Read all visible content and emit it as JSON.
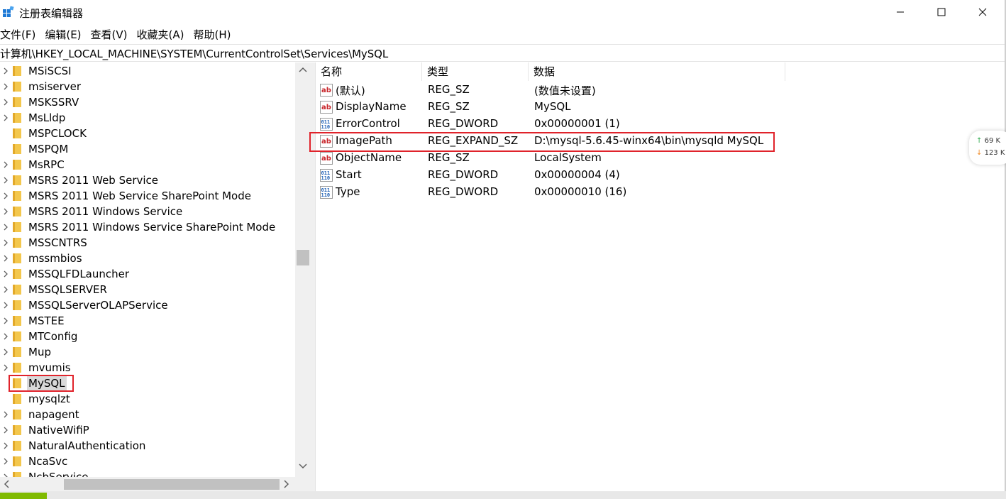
{
  "window": {
    "title": "注册表编辑器",
    "controls": {
      "minimize": "minimize-icon",
      "maximize": "maximize-icon",
      "close": "close-icon"
    }
  },
  "menu": [
    "文件(F)",
    "编辑(E)",
    "查看(V)",
    "收藏夹(A)",
    "帮助(H)"
  ],
  "address": "计算机\\HKEY_LOCAL_MACHINE\\SYSTEM\\CurrentControlSet\\Services\\MySQL",
  "tree": {
    "items": [
      {
        "label": "MSiSCSI",
        "expandable": true
      },
      {
        "label": "msiserver",
        "expandable": true
      },
      {
        "label": "MSKSSRV",
        "expandable": true
      },
      {
        "label": "MsLldp",
        "expandable": true
      },
      {
        "label": "MSPCLOCK",
        "expandable": false
      },
      {
        "label": "MSPQM",
        "expandable": false
      },
      {
        "label": "MsRPC",
        "expandable": true
      },
      {
        "label": "MSRS 2011 Web Service",
        "expandable": true
      },
      {
        "label": "MSRS 2011 Web Service SharePoint Mode",
        "expandable": true
      },
      {
        "label": "MSRS 2011 Windows Service",
        "expandable": true
      },
      {
        "label": "MSRS 2011 Windows Service SharePoint Mode",
        "expandable": true
      },
      {
        "label": "MSSCNTRS",
        "expandable": true
      },
      {
        "label": "mssmbios",
        "expandable": true
      },
      {
        "label": "MSSQLFDLauncher",
        "expandable": true
      },
      {
        "label": "MSSQLSERVER",
        "expandable": true
      },
      {
        "label": "MSSQLServerOLAPService",
        "expandable": true
      },
      {
        "label": "MSTEE",
        "expandable": true
      },
      {
        "label": "MTConfig",
        "expandable": true
      },
      {
        "label": "Mup",
        "expandable": true
      },
      {
        "label": "mvumis",
        "expandable": true
      },
      {
        "label": "MySQL",
        "expandable": false,
        "selected": true
      },
      {
        "label": "mysqlzt",
        "expandable": false
      },
      {
        "label": "napagent",
        "expandable": true
      },
      {
        "label": "NativeWifiP",
        "expandable": true
      },
      {
        "label": "NaturalAuthentication",
        "expandable": true
      },
      {
        "label": "NcaSvc",
        "expandable": true
      },
      {
        "label": "NcbService",
        "expandable": true
      }
    ]
  },
  "values": {
    "headers": {
      "name": "名称",
      "type": "类型",
      "data": "数据"
    },
    "rows": [
      {
        "icon": "string-value-icon",
        "name": "(默认)",
        "type": "REG_SZ",
        "data": "(数值未设置)"
      },
      {
        "icon": "string-value-icon",
        "name": "DisplayName",
        "type": "REG_SZ",
        "data": "MySQL"
      },
      {
        "icon": "binary-value-icon",
        "name": "ErrorControl",
        "type": "REG_DWORD",
        "data": "0x00000001 (1)"
      },
      {
        "icon": "string-value-icon",
        "name": "ImagePath",
        "type": "REG_EXPAND_SZ",
        "data": "D:\\mysql-5.6.45-winx64\\bin\\mysqld MySQL",
        "highlighted": true
      },
      {
        "icon": "string-value-icon",
        "name": "ObjectName",
        "type": "REG_SZ",
        "data": "LocalSystem"
      },
      {
        "icon": "binary-value-icon",
        "name": "Start",
        "type": "REG_DWORD",
        "data": "0x00000004 (4)"
      },
      {
        "icon": "binary-value-icon",
        "name": "Type",
        "type": "REG_DWORD",
        "data": "0x00000010 (16)"
      }
    ]
  },
  "network_widget": {
    "up": "69",
    "up_unit": "K",
    "down": "123",
    "down_unit": "K"
  },
  "colors": {
    "highlight_border": "#e0232b",
    "folder": "#f3c74d",
    "accent": "#0078d7"
  }
}
